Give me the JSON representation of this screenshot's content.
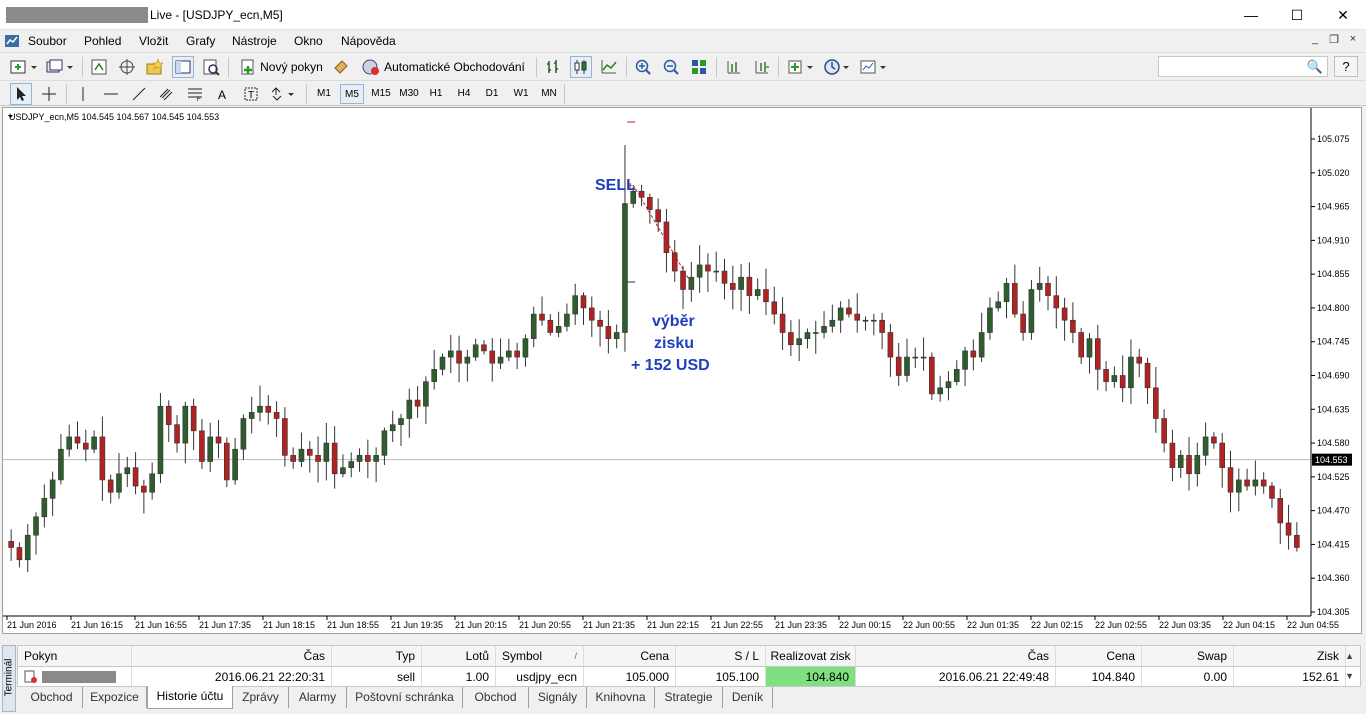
{
  "window": {
    "title": "Live - [USDJPY_ecn,M5]",
    "minimize": "—",
    "maximize": "☐",
    "close": "✕"
  },
  "menu": {
    "items": [
      "Soubor",
      "Pohled",
      "Vložit",
      "Grafy",
      "Nástroje",
      "Okno",
      "Nápověda"
    ],
    "mdi_minimize": "_",
    "mdi_restore": "❐",
    "mdi_close": "×"
  },
  "toolbar": {
    "new_order_label": "Nový pokyn",
    "auto_trading_label": "Automatické Obchodování",
    "search_placeholder": "",
    "search_icon": "🔍",
    "help_icon": "?"
  },
  "timeframes": {
    "items": [
      "M1",
      "M5",
      "M15",
      "M30",
      "H1",
      "H4",
      "D1",
      "W1",
      "MN"
    ],
    "active": "M5"
  },
  "chart": {
    "header": "USDJPY_ecn,M5  104.545 104.567 104.545 104.553",
    "current_price_label": "104.553",
    "annotation_sell": "SELL",
    "annotation_profit_line1": "výběr",
    "annotation_profit_line2": "zisku",
    "annotation_profit_line3": "+ 152 USD",
    "colors": {
      "bull": "#2e5e2e",
      "bear": "#b22222",
      "annotation": "#1f3fbf",
      "grid_line": "#bbbbbb",
      "price_tag_bg": "#000000",
      "price_tag_text": "#ffffff"
    }
  },
  "chart_data": {
    "type": "candlestick",
    "symbol": "USDJPY_ecn",
    "timeframe": "M5",
    "ohlc_last": {
      "open": 104.545,
      "high": 104.567,
      "low": 104.545,
      "close": 104.553
    },
    "ylim": [
      104.305,
      105.075
    ],
    "y_ticks": [
      "105.075",
      "105.020",
      "104.965",
      "104.910",
      "104.855",
      "104.800",
      "104.745",
      "104.690",
      "104.635",
      "104.580",
      "104.525",
      "104.470",
      "104.415",
      "104.360",
      "104.305"
    ],
    "x_ticks": [
      "21 Jun 2016",
      "21 Jun 16:15",
      "21 Jun 16:55",
      "21 Jun 17:35",
      "21 Jun 18:15",
      "21 Jun 18:55",
      "21 Jun 19:35",
      "21 Jun 20:15",
      "21 Jun 20:55",
      "21 Jun 21:35",
      "21 Jun 22:15",
      "21 Jun 22:55",
      "21 Jun 23:35",
      "22 Jun 00:15",
      "22 Jun 00:55",
      "22 Jun 01:35",
      "22 Jun 02:15",
      "22 Jun 02:55",
      "22 Jun 03:35",
      "22 Jun 04:15",
      "22 Jun 04:55"
    ],
    "trade": {
      "type": "sell",
      "open_price": 105.0,
      "close_price": 104.84,
      "profit": "152.61"
    },
    "closes": [
      104.41,
      104.39,
      104.43,
      104.46,
      104.49,
      104.52,
      104.57,
      104.59,
      104.58,
      104.57,
      104.59,
      104.52,
      104.5,
      104.53,
      104.54,
      104.51,
      104.5,
      104.53,
      104.64,
      104.61,
      104.58,
      104.64,
      104.6,
      104.55,
      104.59,
      104.58,
      104.52,
      104.57,
      104.62,
      104.63,
      104.64,
      104.63,
      104.62,
      104.56,
      104.55,
      104.57,
      104.56,
      104.55,
      104.58,
      104.53,
      104.54,
      104.55,
      104.56,
      104.55,
      104.56,
      104.6,
      104.61,
      104.62,
      104.65,
      104.64,
      104.68,
      104.7,
      104.72,
      104.73,
      104.71,
      104.72,
      104.74,
      104.73,
      104.71,
      104.72,
      104.73,
      104.72,
      104.75,
      104.79,
      104.78,
      104.76,
      104.77,
      104.79,
      104.82,
      104.8,
      104.78,
      104.77,
      104.75,
      104.76,
      104.97,
      104.99,
      104.98,
      104.96,
      104.94,
      104.89,
      104.86,
      104.83,
      104.85,
      104.87,
      104.86,
      104.86,
      104.84,
      104.83,
      104.85,
      104.82,
      104.83,
      104.81,
      104.79,
      104.76,
      104.74,
      104.75,
      104.76,
      104.76,
      104.77,
      104.78,
      104.8,
      104.79,
      104.78,
      104.78,
      104.78,
      104.76,
      104.72,
      104.69,
      104.72,
      104.72,
      104.72,
      104.66,
      104.67,
      104.68,
      104.7,
      104.73,
      104.72,
      104.76,
      104.8,
      104.81,
      104.84,
      104.79,
      104.76,
      104.83,
      104.84,
      104.82,
      104.8,
      104.78,
      104.76,
      104.72,
      104.75,
      104.7,
      104.68,
      104.69,
      104.67,
      104.72,
      104.71,
      104.67,
      104.62,
      104.58,
      104.54,
      104.56,
      104.53,
      104.56,
      104.59,
      104.58,
      104.54,
      104.5,
      104.52,
      104.51,
      104.52,
      104.51,
      104.49,
      104.45,
      104.43,
      104.41
    ]
  },
  "terminal": {
    "side_label": "Terminál",
    "columns": [
      "Pokyn",
      "Čas",
      "Typ",
      "Lotů",
      "Symbol",
      "Cena",
      "S / L",
      "Realizovat zisk",
      "Čas",
      "Cena",
      "Swap",
      "Zisk"
    ],
    "sort_indicator": "/",
    "row": {
      "time_open": "2016.06.21 22:20:31",
      "type": "sell",
      "lots": "1.00",
      "symbol": "usdjpy_ecn",
      "price_open": "105.000",
      "sl": "105.100",
      "tp": "104.840",
      "time_close": "2016.06.21 22:49:48",
      "price_close": "104.840",
      "swap": "0.00",
      "profit": "152.61"
    },
    "tabs": [
      "Obchod",
      "Expozice",
      "Historie účtu",
      "Zprávy",
      "Alarmy",
      "Poštovní schránka",
      "Obchod",
      "Signály",
      "Knihovna",
      "Strategie",
      "Deník"
    ],
    "active_tab": "Historie účtu"
  }
}
